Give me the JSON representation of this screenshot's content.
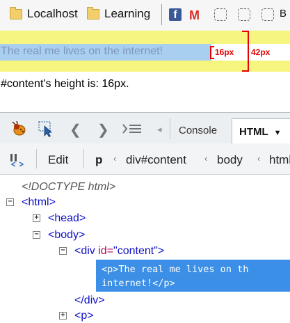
{
  "bookmarks": {
    "items": [
      {
        "label": "Localhost",
        "icon": "folder-icon"
      },
      {
        "label": "Learning",
        "icon": "folder-icon"
      }
    ],
    "facebook_glyph": "f",
    "gmail_glyph": "M",
    "truncated_label": "B"
  },
  "page": {
    "content_text": "The real me lives on the internet!",
    "inner_height_label": "16px",
    "outer_height_label": "42px",
    "height_message": "#content's height is: 16px."
  },
  "colors": {
    "highlight_margin": "#f5f580",
    "highlight_content": "#a8cff0",
    "measure": "#e60000",
    "selected_node": "#3c8fe6",
    "tag": "#1010c8"
  },
  "devtools": {
    "tabs": {
      "console": "Console",
      "html": "HTML",
      "html_arrow": "▼"
    },
    "breadcrumb": {
      "edit": "Edit",
      "crumbs": [
        "p",
        "div#content",
        "body",
        "html"
      ]
    },
    "tree": {
      "doctype": "<!DOCTYPE html>",
      "html_open": "<html>",
      "head": "<head>",
      "body_open": "<body>",
      "div_open_tag": "<div ",
      "div_attr_name": "id=",
      "div_attr_value": "\"content\"",
      "div_open_end": ">",
      "selected_line1": "<p>The real me lives on th",
      "selected_line2": "internet!</p>",
      "div_close": "</div>",
      "p_next": "<p>"
    }
  }
}
